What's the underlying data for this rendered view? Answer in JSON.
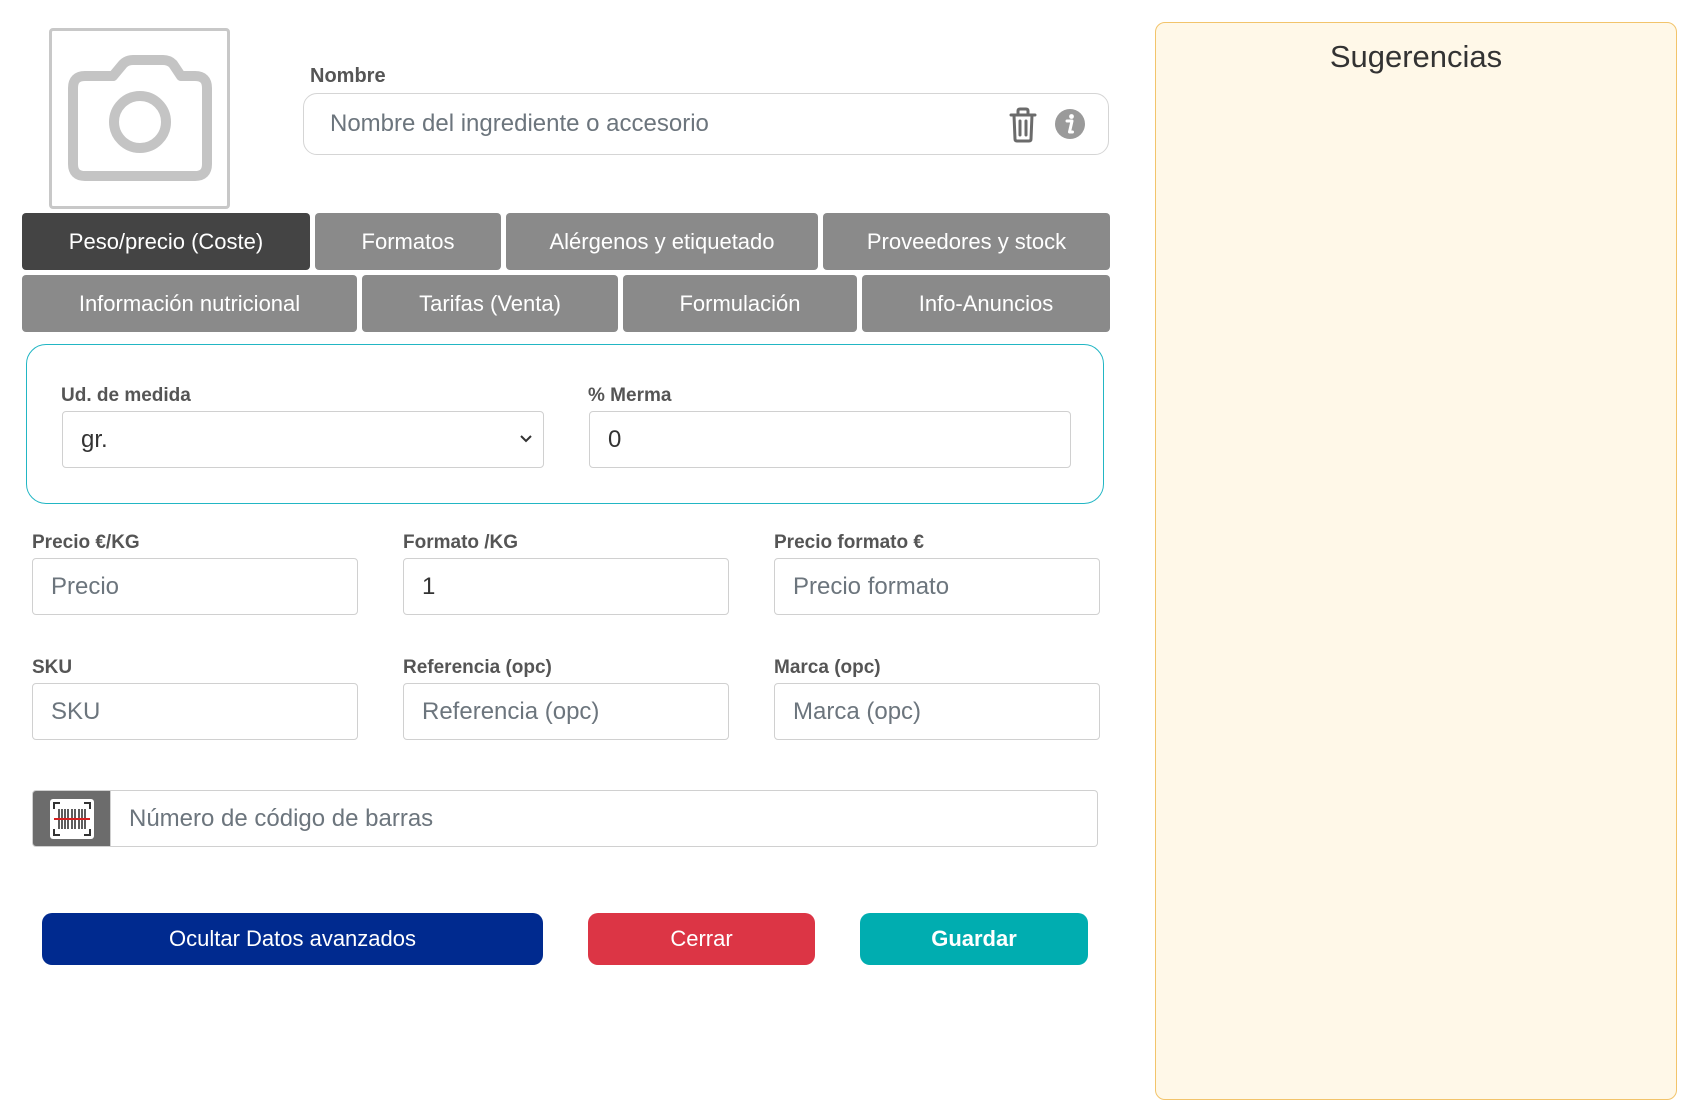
{
  "photo": {
    "icon": "camera-icon"
  },
  "name_field": {
    "label": "Nombre",
    "placeholder": "Nombre del ingrediente o accesorio"
  },
  "tabs": [
    {
      "label": "Peso/precio (Coste)",
      "active": true
    },
    {
      "label": "Formatos"
    },
    {
      "label": "Alérgenos y etiquetado"
    },
    {
      "label": "Proveedores y stock"
    },
    {
      "label": "Información nutricional"
    },
    {
      "label": "Tarifas (Venta)"
    },
    {
      "label": "Formulación"
    },
    {
      "label": "Info-Anuncios"
    }
  ],
  "unit": {
    "label": "Ud. de medida",
    "value": "gr."
  },
  "merma": {
    "label": "% Merma",
    "value": "0"
  },
  "precio": {
    "label": "Precio  €/KG",
    "placeholder": "Precio"
  },
  "formato": {
    "label": "Formato  /KG",
    "value": "1"
  },
  "precio_formato": {
    "label": "Precio formato  €",
    "placeholder": "Precio formato"
  },
  "sku": {
    "label": "SKU",
    "placeholder": "SKU"
  },
  "referencia": {
    "label": "Referencia (opc)",
    "placeholder": "Referencia (opc)"
  },
  "marca": {
    "label": "Marca (opc)",
    "placeholder": "Marca (opc)"
  },
  "barcode": {
    "placeholder": "Número de código de barras"
  },
  "buttons": {
    "advanced": "Ocultar Datos avanzados",
    "close": "Cerrar",
    "save": "Guardar"
  },
  "colors": {
    "advanced": "#002a8f",
    "close": "#dc3545",
    "save": "#00adb0",
    "tab": "#8a8a8a",
    "tab_active": "#444444",
    "panel_border": "#22b6c4",
    "suggest_bg": "#fff8e8"
  },
  "suggestions": {
    "title": "Sugerencias"
  }
}
